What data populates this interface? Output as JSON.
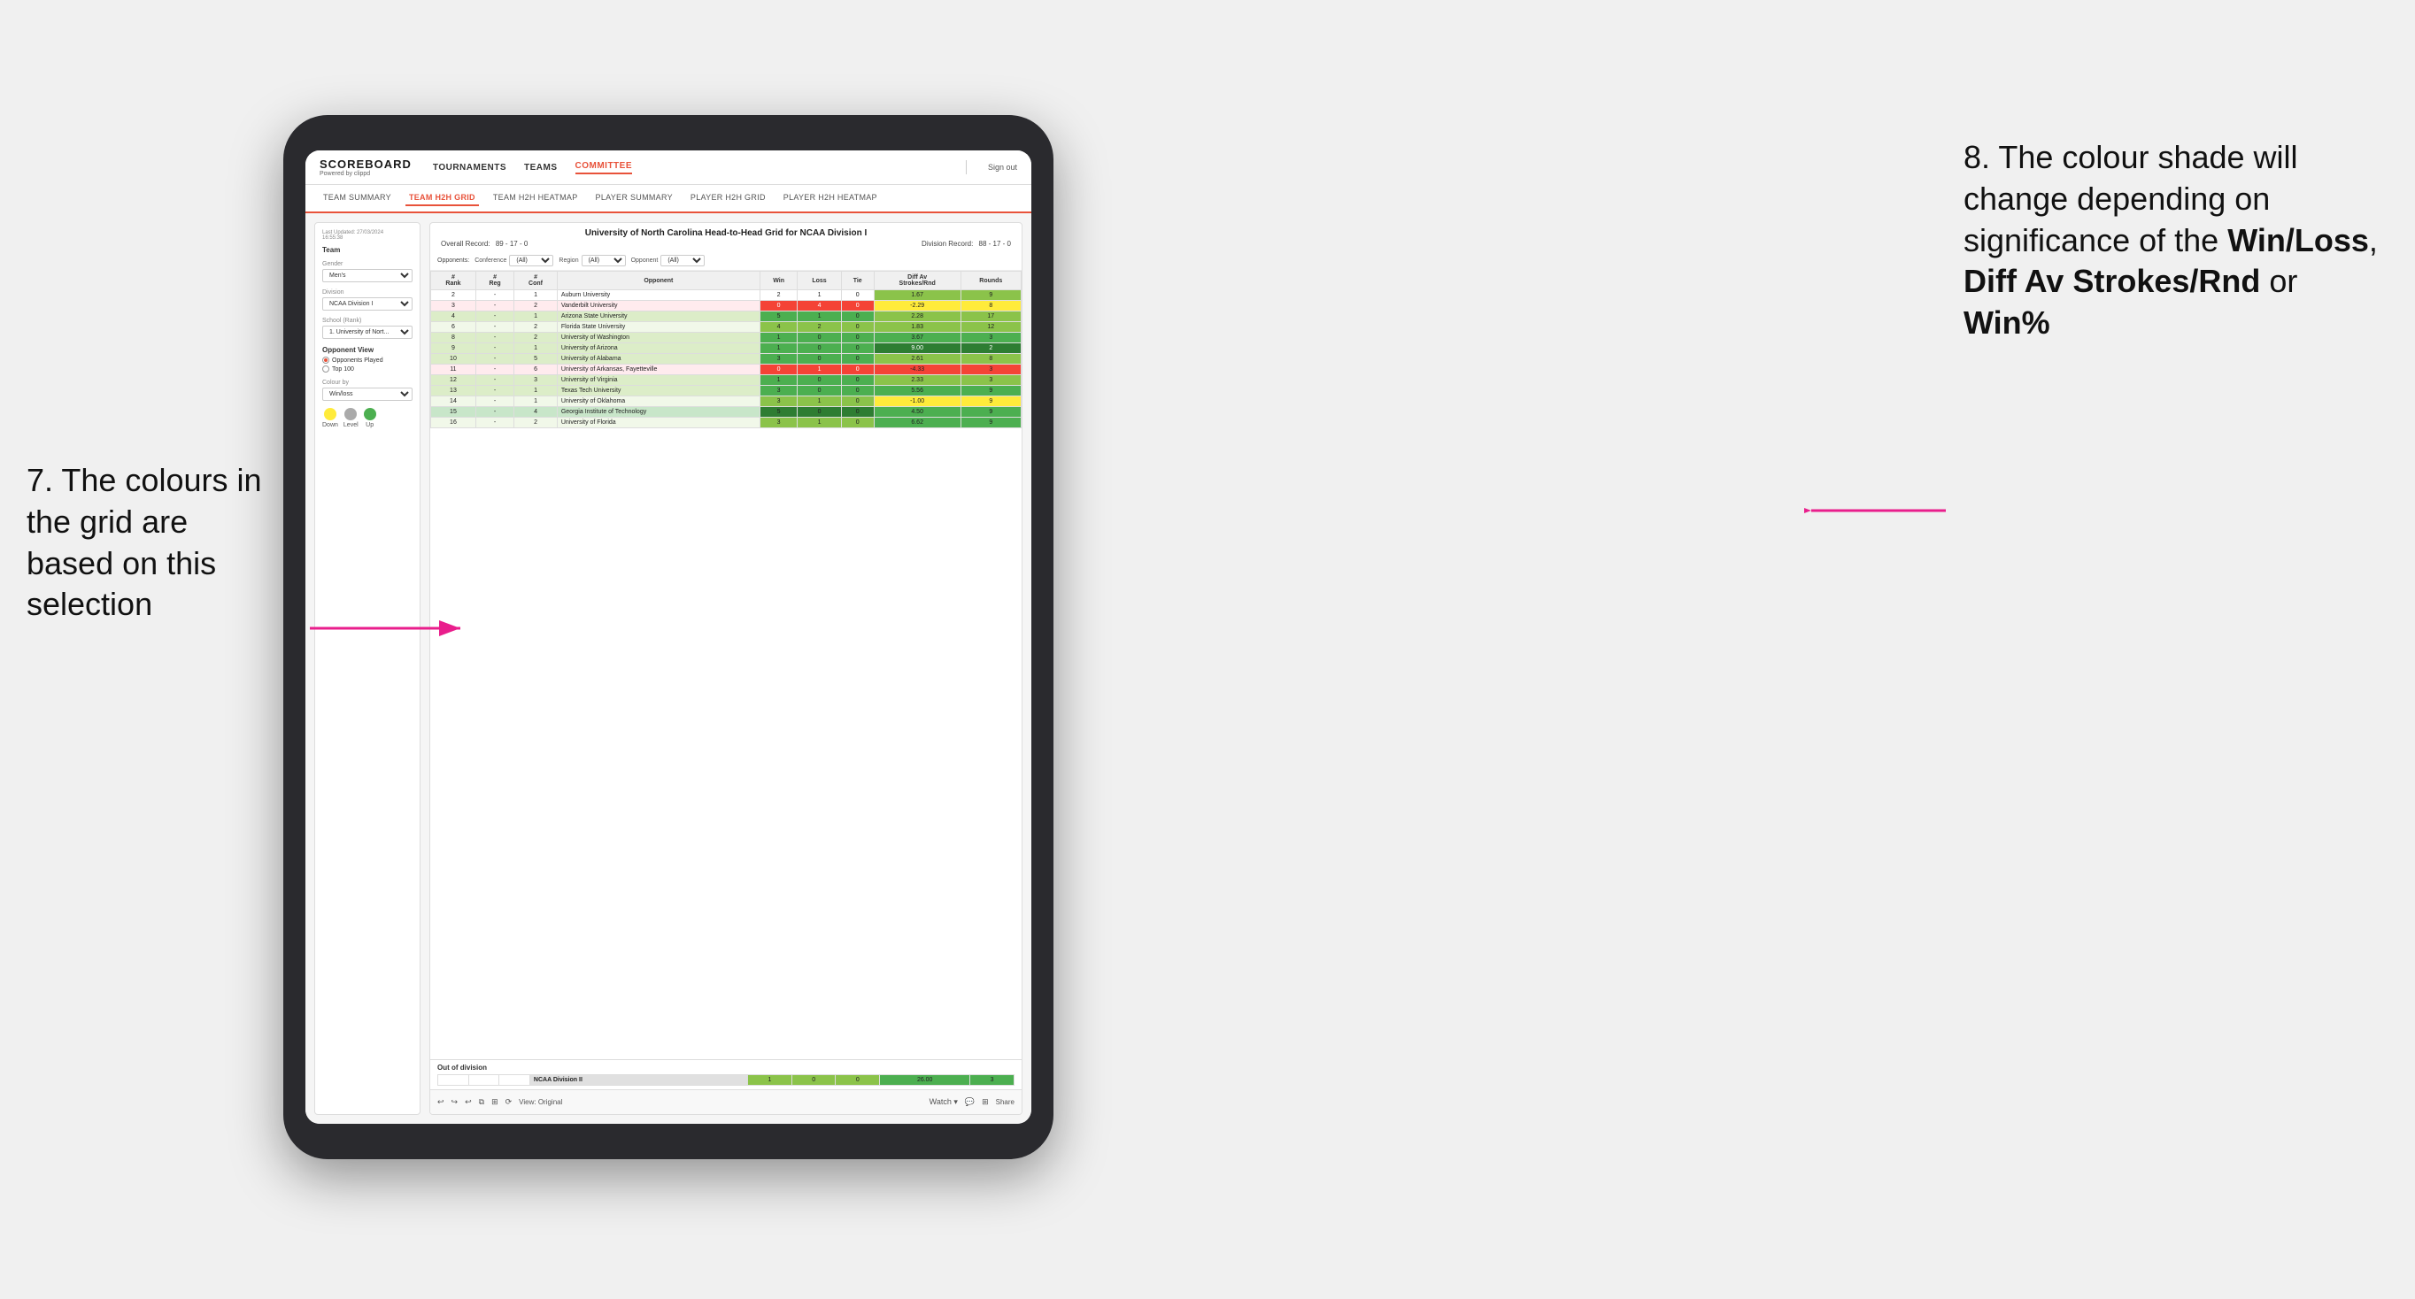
{
  "annotations": {
    "left": {
      "number": "7.",
      "text": "The colours in the grid are based on this selection"
    },
    "right": {
      "number": "8.",
      "text_before": "The colour shade will change depending on significance of the ",
      "bold1": "Win/Loss",
      "text_mid1": ", ",
      "bold2": "Diff Av Strokes/Rnd",
      "text_mid2": " or ",
      "bold3": "Win%"
    }
  },
  "nav": {
    "logo": "SCOREBOARD",
    "logo_sub": "Powered by clippd",
    "items": [
      "TOURNAMENTS",
      "TEAMS",
      "COMMITTEE"
    ],
    "sign_out": "Sign out"
  },
  "sub_nav": {
    "items": [
      "TEAM SUMMARY",
      "TEAM H2H GRID",
      "TEAM H2H HEATMAP",
      "PLAYER SUMMARY",
      "PLAYER H2H GRID",
      "PLAYER H2H HEATMAP"
    ],
    "active": "TEAM H2H GRID"
  },
  "sidebar": {
    "timestamp": "Last Updated: 27/03/2024\n16:55:38",
    "team_label": "Team",
    "gender_label": "Gender",
    "gender_value": "Men's",
    "division_label": "Division",
    "division_value": "NCAA Division I",
    "school_label": "School (Rank)",
    "school_value": "1. University of Nort...",
    "opponent_view_label": "Opponent View",
    "opponent_view_options": [
      "Opponents Played",
      "Top 100"
    ],
    "opponent_view_selected": "Opponents Played",
    "colour_by_label": "Colour by",
    "colour_by_value": "Win/loss",
    "legend": {
      "down_label": "Down",
      "level_label": "Level",
      "up_label": "Up",
      "down_color": "#ffeb3b",
      "level_color": "#aaaaaa",
      "up_color": "#4caf50"
    }
  },
  "grid": {
    "title": "University of North Carolina Head-to-Head Grid for NCAA Division I",
    "overall_record_label": "Overall Record:",
    "overall_record": "89 - 17 - 0",
    "division_record_label": "Division Record:",
    "division_record": "88 - 17 - 0",
    "filters": {
      "opponents_label": "Opponents:",
      "conference_label": "Conference",
      "conference_value": "(All)",
      "region_label": "Region",
      "region_value": "(All)",
      "opponent_label": "Opponent",
      "opponent_value": "(All)"
    },
    "table_headers": [
      "#\nRank",
      "#\nReg",
      "#\nConf",
      "Opponent",
      "Win",
      "Loss",
      "Tie",
      "Diff Av\nStrokes/Rnd",
      "Rounds"
    ],
    "rows": [
      {
        "rank": "2",
        "reg": "-",
        "conf": "1",
        "opponent": "Auburn University",
        "win": "2",
        "loss": "1",
        "tie": "0",
        "diff": "1.67",
        "rounds": "9",
        "win_color": "white",
        "diff_color": "green_light"
      },
      {
        "rank": "3",
        "reg": "-",
        "conf": "2",
        "opponent": "Vanderbilt University",
        "win": "0",
        "loss": "4",
        "tie": "0",
        "diff": "-2.29",
        "rounds": "8",
        "win_color": "red",
        "diff_color": "yellow"
      },
      {
        "rank": "4",
        "reg": "-",
        "conf": "1",
        "opponent": "Arizona State University",
        "win": "5",
        "loss": "1",
        "tie": "0",
        "diff": "2.28",
        "rounds": "17",
        "win_color": "green",
        "diff_color": "green_light"
      },
      {
        "rank": "6",
        "reg": "-",
        "conf": "2",
        "opponent": "Florida State University",
        "win": "4",
        "loss": "2",
        "tie": "0",
        "diff": "1.83",
        "rounds": "12",
        "win_color": "green_light",
        "diff_color": "green_light"
      },
      {
        "rank": "8",
        "reg": "-",
        "conf": "2",
        "opponent": "University of Washington",
        "win": "1",
        "loss": "0",
        "tie": "0",
        "diff": "3.67",
        "rounds": "3",
        "win_color": "green",
        "diff_color": "green"
      },
      {
        "rank": "9",
        "reg": "-",
        "conf": "1",
        "opponent": "University of Arizona",
        "win": "1",
        "loss": "0",
        "tie": "0",
        "diff": "9.00",
        "rounds": "2",
        "win_color": "green",
        "diff_color": "green_dark"
      },
      {
        "rank": "10",
        "reg": "-",
        "conf": "5",
        "opponent": "University of Alabama",
        "win": "3",
        "loss": "0",
        "tie": "0",
        "diff": "2.61",
        "rounds": "8",
        "win_color": "green",
        "diff_color": "green_light"
      },
      {
        "rank": "11",
        "reg": "-",
        "conf": "6",
        "opponent": "University of Arkansas, Fayetteville",
        "win": "0",
        "loss": "1",
        "tie": "0",
        "diff": "-4.33",
        "rounds": "3",
        "win_color": "red",
        "diff_color": "red"
      },
      {
        "rank": "12",
        "reg": "-",
        "conf": "3",
        "opponent": "University of Virginia",
        "win": "1",
        "loss": "0",
        "tie": "0",
        "diff": "2.33",
        "rounds": "3",
        "win_color": "green",
        "diff_color": "green_light"
      },
      {
        "rank": "13",
        "reg": "-",
        "conf": "1",
        "opponent": "Texas Tech University",
        "win": "3",
        "loss": "0",
        "tie": "0",
        "diff": "5.56",
        "rounds": "9",
        "win_color": "green",
        "diff_color": "green"
      },
      {
        "rank": "14",
        "reg": "-",
        "conf": "1",
        "opponent": "University of Oklahoma",
        "win": "3",
        "loss": "1",
        "tie": "0",
        "diff": "-1.00",
        "rounds": "9",
        "win_color": "green_light",
        "diff_color": "yellow"
      },
      {
        "rank": "15",
        "reg": "-",
        "conf": "4",
        "opponent": "Georgia Institute of Technology",
        "win": "5",
        "loss": "0",
        "tie": "0",
        "diff": "4.50",
        "rounds": "9",
        "win_color": "green_dark",
        "diff_color": "green"
      },
      {
        "rank": "16",
        "reg": "-",
        "conf": "2",
        "opponent": "University of Florida",
        "win": "3",
        "loss": "1",
        "tie": "0",
        "diff": "6.62",
        "rounds": "9",
        "win_color": "green_light",
        "diff_color": "green"
      }
    ],
    "out_of_division_label": "Out of division",
    "out_of_division_rows": [
      {
        "division": "NCAA Division II",
        "win": "1",
        "loss": "0",
        "tie": "0",
        "diff": "26.00",
        "rounds": "3"
      }
    ]
  },
  "toolbar": {
    "view_label": "View: Original",
    "watch_label": "Watch ▾",
    "share_label": "Share"
  }
}
